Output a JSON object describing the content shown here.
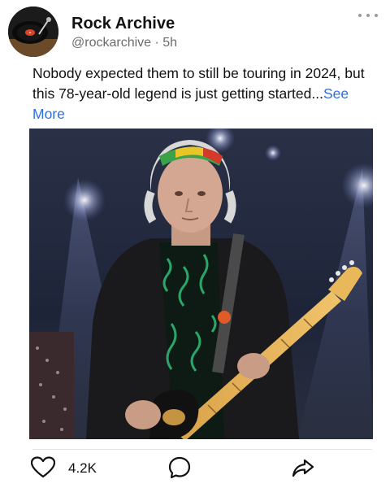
{
  "post": {
    "account_name": "Rock Archive",
    "handle": "@rockarchive",
    "separator": "·",
    "time": "5h",
    "text": "Nobody expected them to still be touring in 2024, but this 78-year-old legend is just getting started...",
    "see_more": "See More"
  },
  "actions": {
    "likes": "4.2K"
  },
  "icons": {
    "more": "more-horizontal-icon",
    "like": "heart-icon",
    "comment": "comment-icon",
    "share": "share-icon"
  },
  "colors": {
    "link": "#2f6fdc",
    "muted": "#6b6b6b"
  }
}
